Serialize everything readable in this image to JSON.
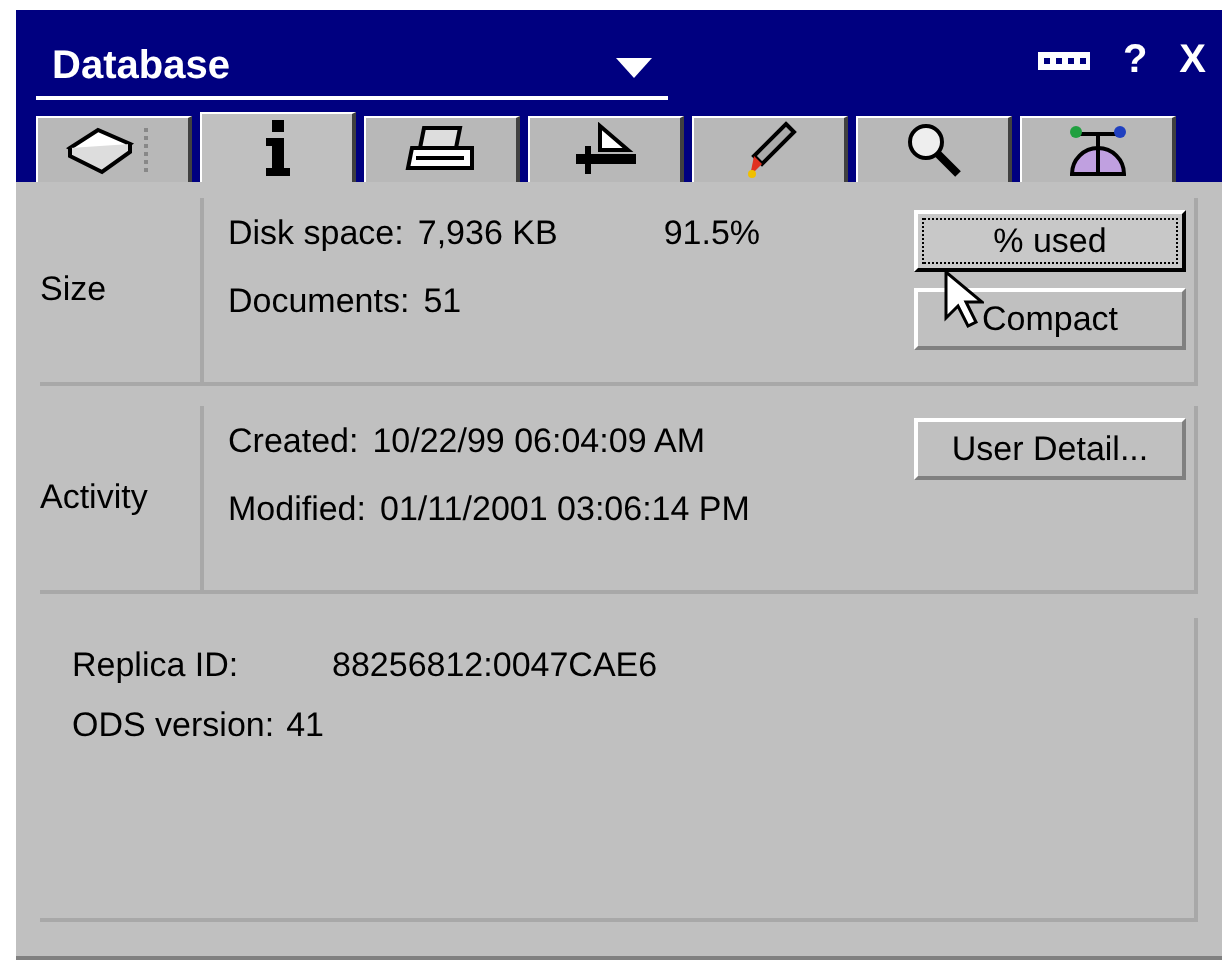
{
  "window": {
    "title": "Database",
    "help_button": "?",
    "close_button": "X"
  },
  "tabs": [
    {
      "selected": false
    },
    {
      "selected": true
    },
    {
      "selected": false
    },
    {
      "selected": false
    },
    {
      "selected": false
    },
    {
      "selected": false
    },
    {
      "selected": false
    }
  ],
  "groups": [
    {
      "label": "Size",
      "lines": [
        {
          "label": "Disk space:",
          "value": "7,936 KB",
          "extra": "91.5%"
        },
        {
          "label": "Documents:",
          "value": "51"
        }
      ],
      "buttons": [
        {
          "label": "% used",
          "focused": true
        },
        {
          "label": "Compact",
          "focused": false
        }
      ]
    },
    {
      "label": "Activity",
      "lines": [
        {
          "label": "Created:",
          "value": "10/22/99 06:04:09 AM"
        },
        {
          "label": "Modified:",
          "value": "01/11/2001 03:06:14 PM"
        }
      ],
      "buttons": [
        {
          "label": "User Detail...",
          "focused": false
        }
      ]
    }
  ],
  "info": [
    {
      "label": "Replica ID:",
      "value": "88256812:0047CAE6"
    },
    {
      "label": "ODS version:",
      "value": "41"
    }
  ]
}
